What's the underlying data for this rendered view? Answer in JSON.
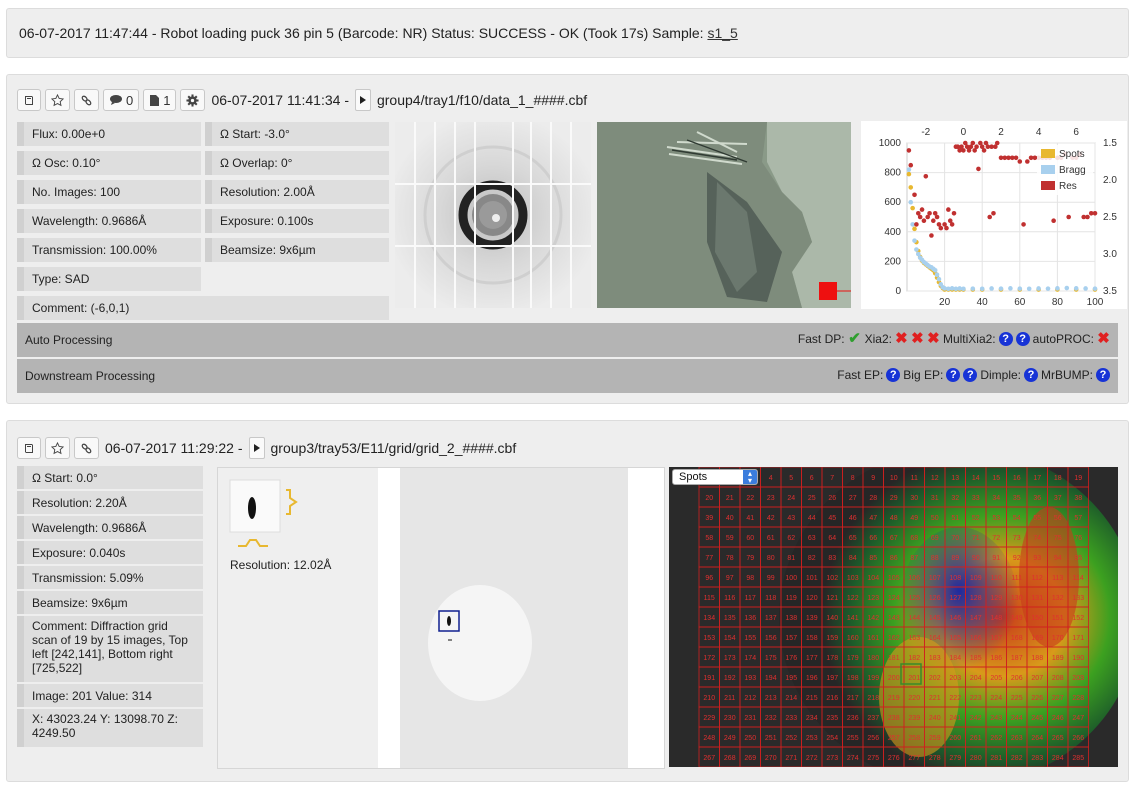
{
  "log": {
    "text": "06-07-2017 11:47:44 - Robot loading puck 36 pin 5 (Barcode: NR) Status: SUCCESS - OK (Took 17s) Sample: ",
    "sample_link": "s1_5"
  },
  "dc1": {
    "comments_count": "0",
    "files_count": "1",
    "timestamp": "06-07-2017 11:41:34 -",
    "path": "group4/tray1/f10/data_1_####.cbf",
    "left_fields": [
      "Flux: 0.00e+0",
      "Ω Osc: 0.10°",
      "No. Images: 100",
      "Wavelength: 0.9686Å",
      "Transmission: 100.00%",
      "Type: SAD",
      "Comment:  (-6,0,1)"
    ],
    "right_fields": [
      "Ω Start: -3.0°",
      "Ω Overlap: 0°",
      "Resolution: 2.00Å",
      "Exposure: 0.100s",
      "Beamsize: 9x6µm"
    ],
    "auto_processing": {
      "label": "Auto Processing",
      "fastdp_label": "Fast DP:",
      "xia2_label": "Xia2:",
      "multixia2_label": "MultiXia2:",
      "autoproc_label": "autoPROC:"
    },
    "downstream": {
      "label": "Downstream Processing",
      "fastep_label": "Fast EP:",
      "bigep_label": "Big EP:",
      "dimple_label": "Dimple:",
      "mrbump_label": "MrBUMP:"
    },
    "colors": {
      "spots": "#e8b830",
      "bragg": "#a8d0ee",
      "res": "#c03030",
      "status_ok": "#2e9e2e",
      "status_fail": "#e02020",
      "status_unknown": "#1733d6"
    }
  },
  "chart_data": {
    "type": "scatter",
    "x_bottom_ticks": [
      "20",
      "40",
      "60",
      "80",
      "100"
    ],
    "x_top_ticks": [
      "-2",
      "0",
      "2",
      "4",
      "6"
    ],
    "y_left_ticks": [
      "1000",
      "800",
      "600",
      "400",
      "200",
      "0"
    ],
    "y_right_ticks": [
      "1.5",
      "2.0",
      "2.5",
      "3.0",
      "3.5"
    ],
    "xlim": [
      0,
      100
    ],
    "ylim_left": [
      0,
      1000
    ],
    "ylim_right": [
      1.5,
      3.5
    ],
    "legend_placement": "top-right",
    "grid": true,
    "series": [
      {
        "name": "Spots",
        "axis": "left",
        "x": [
          1,
          2,
          3,
          4,
          5,
          6,
          7,
          8,
          9,
          10,
          11,
          12,
          13,
          14,
          15,
          16,
          17,
          18,
          19,
          20,
          22,
          24,
          26,
          28,
          30,
          35,
          40,
          50,
          60,
          70,
          80,
          90,
          100
        ],
        "y": [
          790,
          700,
          560,
          420,
          330,
          270,
          230,
          205,
          190,
          180,
          170,
          160,
          150,
          140,
          120,
          90,
          60,
          35,
          20,
          10,
          10,
          10,
          10,
          10,
          10,
          10,
          10,
          10,
          10,
          10,
          10,
          10,
          10
        ]
      },
      {
        "name": "Bragg",
        "axis": "left",
        "x": [
          1,
          2,
          3,
          4,
          5,
          6,
          7,
          8,
          9,
          10,
          11,
          12,
          13,
          14,
          15,
          16,
          17,
          18,
          19,
          20,
          22,
          24,
          26,
          28,
          30,
          35,
          40,
          45,
          50,
          55,
          60,
          65,
          70,
          75,
          80,
          85,
          90,
          95,
          100
        ],
        "y": [
          820,
          600,
          450,
          340,
          280,
          250,
          225,
          210,
          195,
          185,
          175,
          165,
          160,
          150,
          140,
          110,
          80,
          45,
          25,
          18,
          15,
          18,
          15,
          17,
          15,
          16,
          15,
          17,
          16,
          18,
          16,
          15,
          17,
          16,
          18,
          20,
          18,
          17,
          16
        ]
      },
      {
        "name": "Res",
        "axis": "right",
        "x": [
          1,
          2,
          4,
          5,
          6,
          7,
          8,
          9,
          10,
          11,
          12,
          13,
          14,
          15,
          16,
          17,
          18,
          20,
          21,
          22,
          23,
          24,
          25,
          26,
          27,
          28,
          29,
          30,
          31,
          32,
          33,
          34,
          35,
          36,
          37,
          38,
          39,
          40,
          41,
          42,
          43,
          44,
          45,
          46,
          47,
          48,
          50,
          52,
          54,
          56,
          58,
          60,
          62,
          64,
          66,
          68,
          70,
          72,
          74,
          76,
          78,
          80,
          82,
          84,
          86,
          88,
          90,
          92,
          94,
          96,
          98,
          100
        ],
        "y": [
          1.6,
          1.8,
          2.2,
          2.6,
          2.45,
          2.5,
          2.4,
          2.55,
          1.95,
          2.5,
          2.45,
          2.75,
          2.55,
          2.45,
          2.5,
          2.6,
          2.65,
          2.6,
          2.65,
          2.4,
          2.55,
          2.6,
          2.45,
          1.55,
          1.55,
          1.6,
          1.55,
          1.6,
          1.5,
          1.55,
          1.6,
          1.55,
          1.5,
          1.6,
          1.55,
          1.85,
          1.5,
          1.55,
          1.6,
          1.5,
          1.55,
          2.5,
          1.55,
          2.45,
          1.55,
          1.5,
          1.7,
          1.7,
          1.7,
          1.7,
          1.7,
          1.75,
          2.6,
          1.75,
          1.7,
          1.7,
          1.7,
          1.7,
          1.7,
          1.7,
          2.55,
          1.7,
          1.7,
          1.65,
          2.5,
          1.7,
          1.7,
          1.65,
          2.5,
          2.5,
          2.45,
          2.45
        ]
      }
    ]
  },
  "dc2": {
    "timestamp": "06-07-2017 11:29:22 -",
    "path": "group3/tray53/E11/grid/grid_2_####.cbf",
    "fields": [
      "Ω Start: 0.0°",
      "Resolution: 2.20Å",
      "Wavelength: 0.9686Å",
      "Exposure: 0.040s",
      "Transmission: 5.09%",
      "Beamsize: 9x6µm"
    ],
    "comment": "Comment:  Diffraction grid scan of 19 by 15 images, Top left [242,141], Bottom right [725,522]",
    "image_value": "Image: 201 Value: 314",
    "position": "X: 43023.24 Y: 13098.70 Z: 4249.50",
    "thumb_resolution": "Resolution: 12.02Å",
    "heatmap_select": "Spots"
  }
}
